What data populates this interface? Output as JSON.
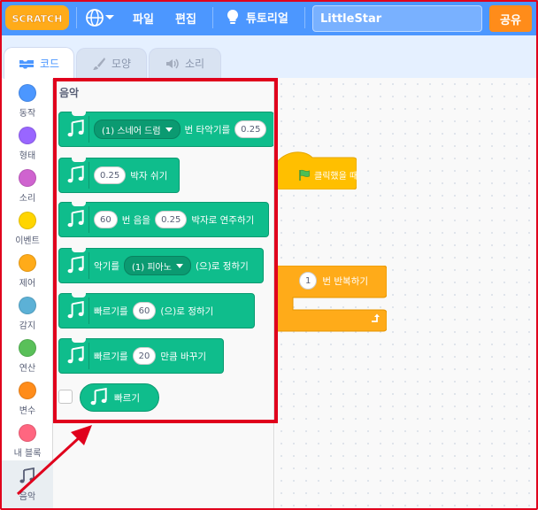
{
  "menubar": {
    "logo_text": "SCRATCH",
    "file": "파일",
    "edit": "편집",
    "tutorial": "튜토리얼",
    "project_title": "LittleStar",
    "share": "공유"
  },
  "tabs": [
    {
      "label": "코드",
      "active": true
    },
    {
      "label": "모양",
      "active": false
    },
    {
      "label": "소리",
      "active": false
    }
  ],
  "categories": [
    {
      "label": "동작",
      "color": "#4c97ff"
    },
    {
      "label": "형태",
      "color": "#9966ff"
    },
    {
      "label": "소리",
      "color": "#cf63cf"
    },
    {
      "label": "이벤트",
      "color": "#ffd500"
    },
    {
      "label": "제어",
      "color": "#ffab19"
    },
    {
      "label": "감지",
      "color": "#5cb1d6"
    },
    {
      "label": "연산",
      "color": "#59c059"
    },
    {
      "label": "변수",
      "color": "#ff8c1a"
    },
    {
      "label": "내 블록",
      "color": "#ff6680"
    },
    {
      "label": "음악",
      "color": "#0fbd8c",
      "selected": true
    }
  ],
  "palette": {
    "title": "음악",
    "blocks": {
      "drum": {
        "dropdown": "(1) 스네어 드럼",
        "mid": "번 타악기를",
        "value": "0.25"
      },
      "rest": {
        "value": "0.25",
        "suffix": "박자 쉬기"
      },
      "note": {
        "value1": "60",
        "mid": "번 음을",
        "value2": "0.25",
        "suffix": "박자로 연주하기"
      },
      "instrument": {
        "prefix": "악기를",
        "dropdown": "(1) 피아노",
        "suffix": "(으)로 정하기"
      },
      "set_tempo": {
        "prefix": "빠르기를",
        "value": "60",
        "suffix": "(으)로 정하기"
      },
      "change_tempo": {
        "prefix": "빠르기를",
        "value": "20",
        "suffix": "만큼 바꾸기"
      },
      "tempo_reporter": {
        "label": "빠르기"
      }
    }
  },
  "workspace": {
    "hat_label": "클릭했을 때",
    "repeat_value": "1",
    "repeat_suffix": "번 반복하기"
  },
  "colors": {
    "menubar": "#4c97ff",
    "music": "#0fbd8c",
    "events": "#ffbf00",
    "control": "#ffab19",
    "share": "#ff8c1a",
    "annotation": "#e0001c"
  }
}
